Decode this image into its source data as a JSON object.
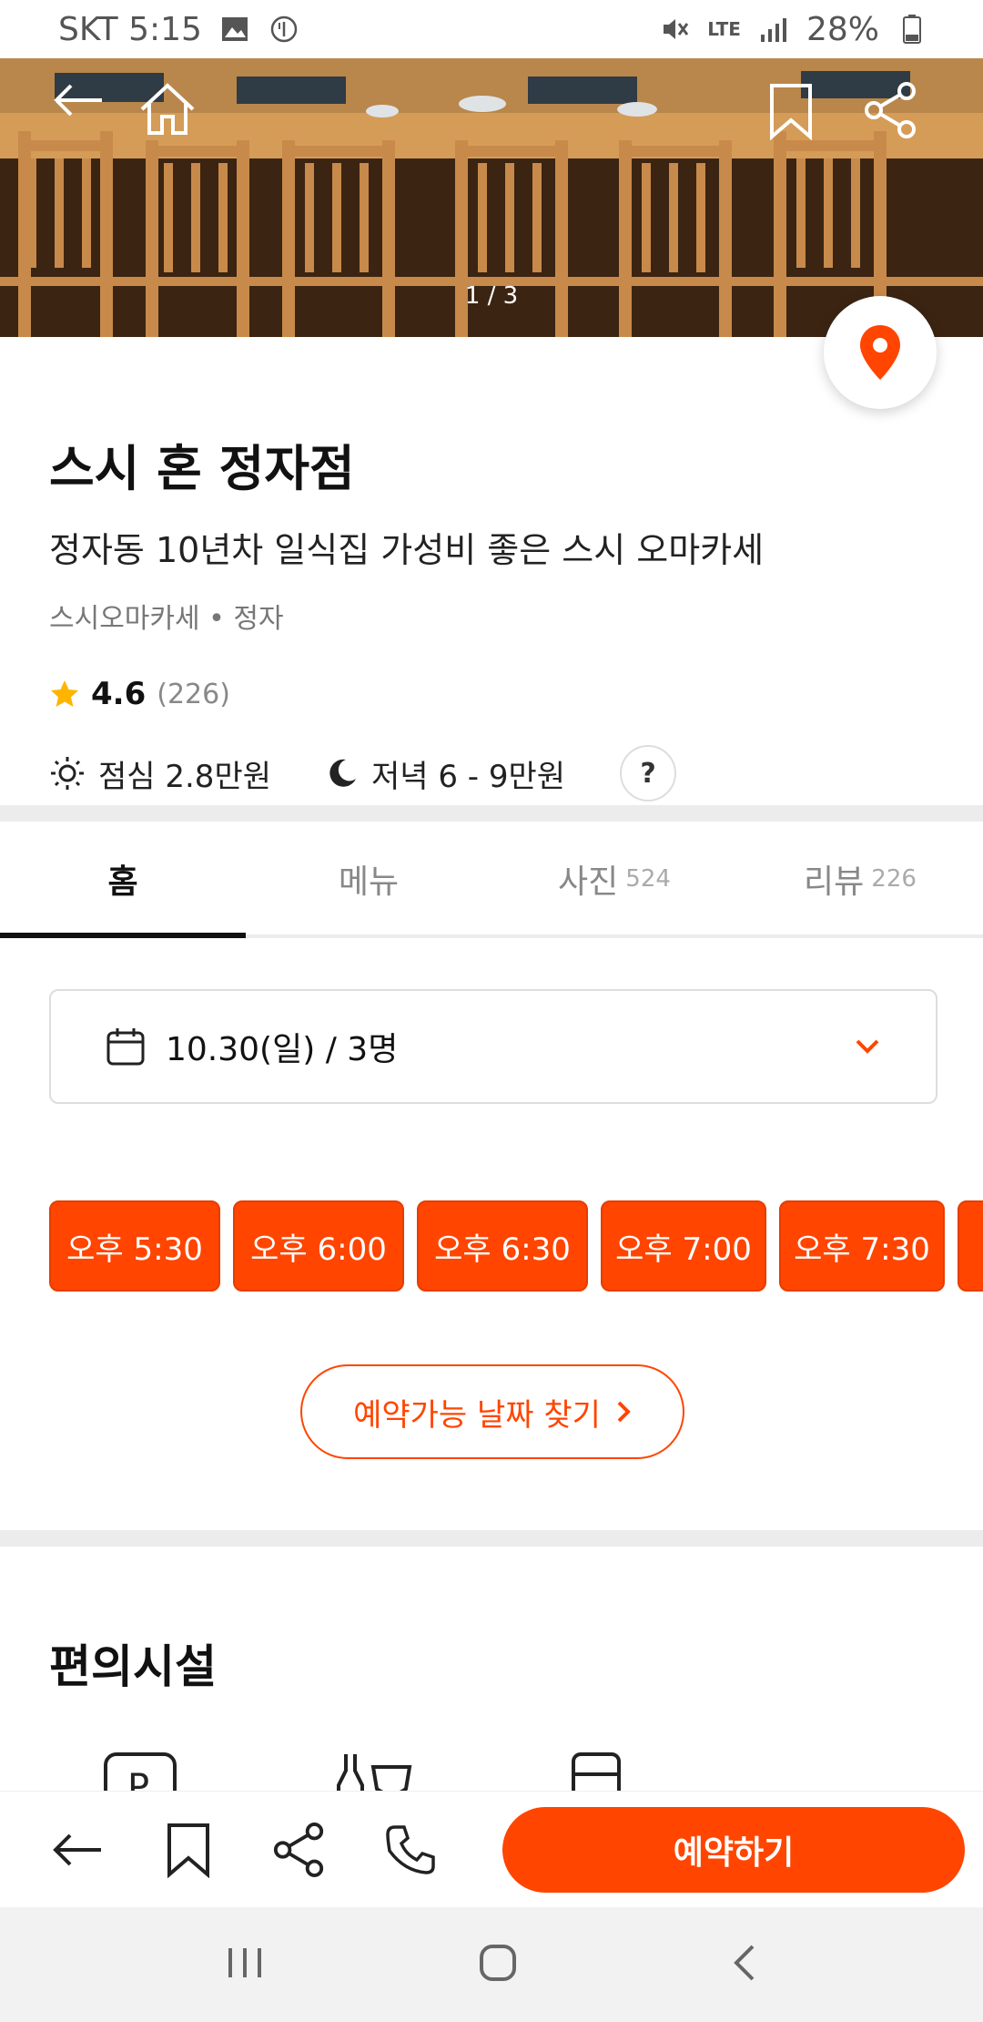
{
  "status": {
    "carrier_time": "SKT 5:15",
    "network": "LTE",
    "battery": "28%"
  },
  "hero": {
    "counter": "1 / 3"
  },
  "restaurant": {
    "name": "스시 혼 정자점",
    "tagline": "정자동 10년차 일식집 가성비 좋은 스시 오마카세",
    "category": "스시오마카세 • 정자",
    "rating": "4.6",
    "review_count": "(226)",
    "lunch_price": "점심 2.8만원",
    "dinner_price": "저녁 6 - 9만원",
    "help": "?"
  },
  "tabs": [
    {
      "label": "홈",
      "count": ""
    },
    {
      "label": "메뉴",
      "count": ""
    },
    {
      "label": "사진",
      "count": "524"
    },
    {
      "label": "리뷰",
      "count": "226"
    }
  ],
  "booking": {
    "date_party": "10.30(일) / 3명",
    "slots": [
      "오후 5:30",
      "오후 6:00",
      "오후 6:30",
      "오후 7:00",
      "오후 7:30"
    ],
    "find_dates": "예약가능 날짜 찾기"
  },
  "facilities": {
    "title": "편의시설"
  },
  "bottom_bar": {
    "reserve": "예약하기"
  },
  "colors": {
    "accent": "#ff4500"
  },
  "icons": [
    "back-arrow-icon",
    "home-icon",
    "bookmark-icon",
    "share-icon",
    "map-pin-icon",
    "star-icon",
    "sun-icon",
    "moon-icon",
    "calendar-icon",
    "chevron-down-icon",
    "chevron-right-icon",
    "phone-icon"
  ]
}
